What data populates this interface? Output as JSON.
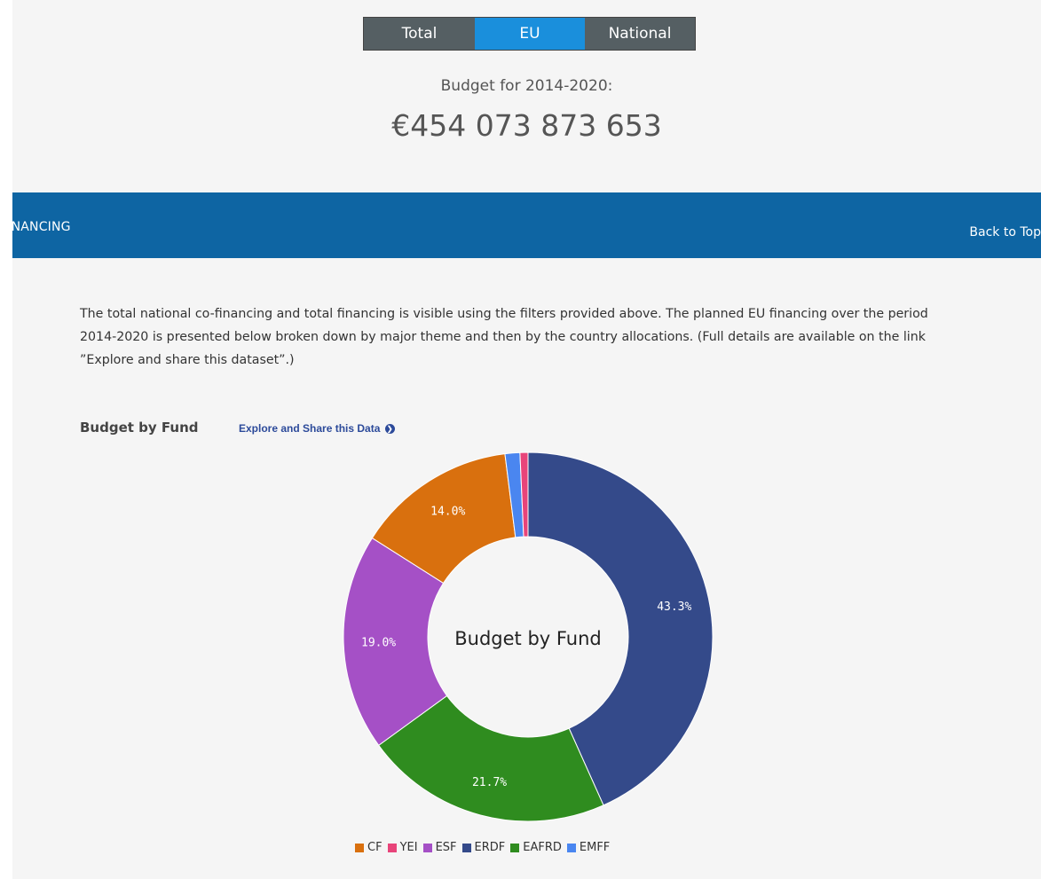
{
  "toggle": {
    "total": "Total",
    "eu": "EU",
    "national": "National",
    "active": "EU"
  },
  "budget": {
    "label": "Budget for 2014-2020:",
    "value": "€454 073 873 653"
  },
  "section": {
    "title": "FINANCING",
    "back_to_top": "Back to Top"
  },
  "intro_text": "The total national co-financing and total financing is visible using the filters provided above. The planned EU financing over the period 2014-2020 is presented below broken down by major theme and then by the country allocations. (Full details are available on the link ”Explore and share this dataset”.)",
  "chart_section": {
    "heading": "Budget by Fund",
    "explore_link": "Explore and Share this Data",
    "explore_icon": "circle-arrow-right-icon"
  },
  "chart_data": {
    "type": "pie",
    "title": "Budget by Fund",
    "donut": true,
    "legend_position": "bottom",
    "slices": [
      {
        "name": "ERDF",
        "value": 43.3,
        "label": "43.3%",
        "color": "#344a8a"
      },
      {
        "name": "EAFRD",
        "value": 21.7,
        "label": "21.7%",
        "color": "#2f8c1f"
      },
      {
        "name": "ESF",
        "value": 19.0,
        "label": "19.0%",
        "color": "#a550c6"
      },
      {
        "name": "CF",
        "value": 14.0,
        "label": "14.0%",
        "color": "#d9700e"
      },
      {
        "name": "EMFF",
        "value": 1.3,
        "label": "",
        "color": "#4a86f0"
      },
      {
        "name": "YEI",
        "value": 0.7,
        "label": "",
        "color": "#e8447a"
      }
    ],
    "legend": [
      {
        "name": "CF",
        "color": "#d9700e"
      },
      {
        "name": "YEI",
        "color": "#e8447a"
      },
      {
        "name": "ESF",
        "color": "#a550c6"
      },
      {
        "name": "ERDF",
        "color": "#344a8a"
      },
      {
        "name": "EAFRD",
        "color": "#2f8c1f"
      },
      {
        "name": "EMFF",
        "color": "#4a86f0"
      }
    ]
  }
}
